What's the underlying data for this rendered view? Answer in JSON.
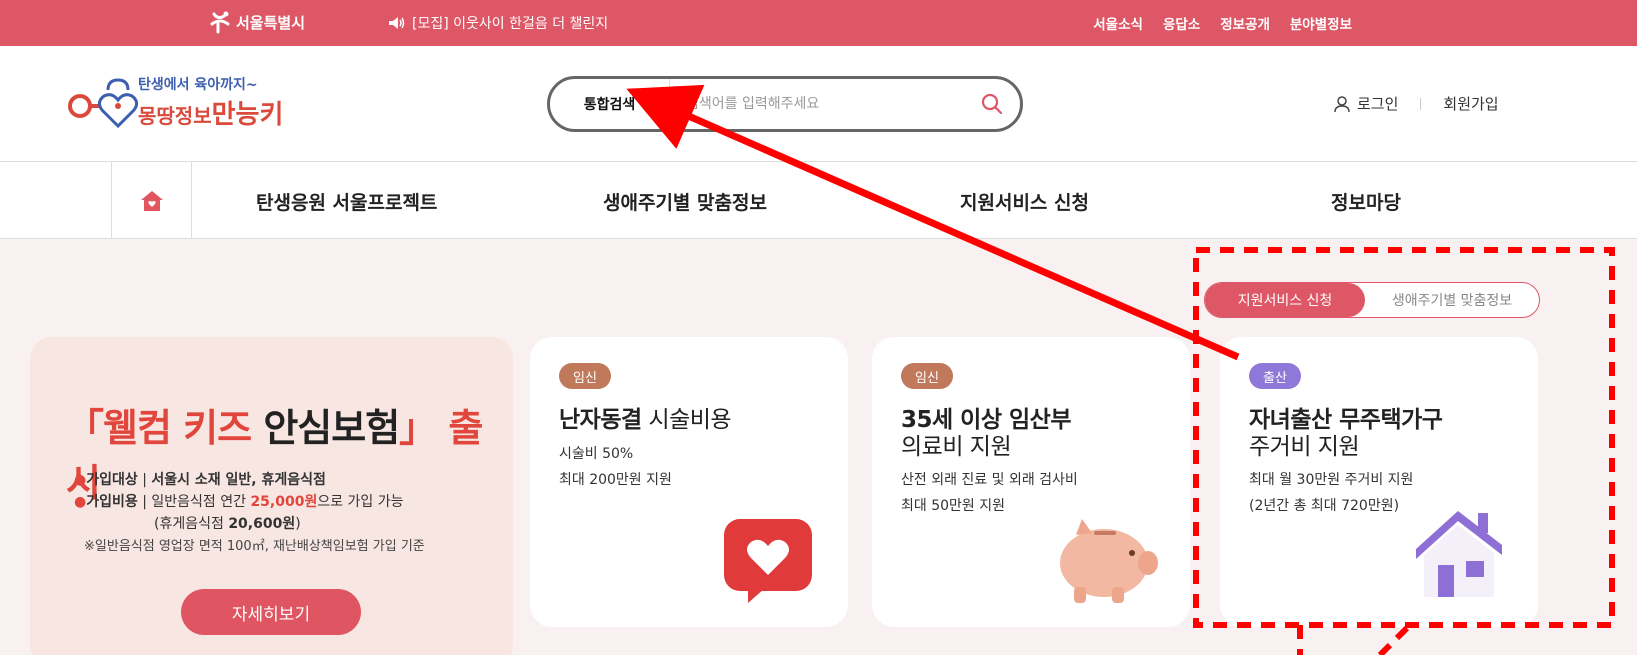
{
  "topbar": {
    "city_logo": "서울특별시",
    "notice": "[모집] 이웃사이 한걸음 더 챌린지",
    "links": [
      "서울소식",
      "응답소",
      "정보공개",
      "분야별정보"
    ]
  },
  "header": {
    "brand_line1": "탄생에서 육아까지~",
    "brand_line2": "몽땅정보",
    "brand_line2_bold": "만능키",
    "search_tab": "통합검색",
    "search_placeholder": "검색어를 입력해주세요",
    "login": "로그인",
    "join": "회원가입"
  },
  "nav": {
    "items": [
      "탄생응원 서울프로젝트",
      "생애주기별 맞춤정보",
      "지원서비스 신청",
      "정보마당"
    ]
  },
  "toggle": {
    "active": "지원서비스 신청",
    "inactive": "생애주기별 맞춤정보"
  },
  "banner": {
    "title_open": "「",
    "title_main": "웰컴 키즈",
    "title_mid": " 안심보험",
    "title_close": "」",
    "title_end": "출시",
    "line1_label": "가입대상",
    "line1_value": "서울시 소재 일반, 휴게음식점",
    "line2_label": "가입비용",
    "line2_pre": "일반음식점 연간 ",
    "line2_amount": "25,000원",
    "line2_post": "으로 가입 가능",
    "line3": "(휴게음식점 ",
    "line3_amount": "20,600원",
    "line3_close": ")",
    "note": "※일반음식점 영업장 면적 100㎡, 재난배상책임보험 가입 기준",
    "more": "자세히보기"
  },
  "cards": [
    {
      "tag": "임신",
      "title_bold": "난자동결",
      "title_rest": " 시술비용",
      "title_line2": "",
      "desc1": "시술비 50%",
      "desc2": "최대 200만원 지원"
    },
    {
      "tag": "임신",
      "title_bold": "35세 이상 임산부",
      "title_rest": "",
      "title_line2": "의료비 지원",
      "desc1": "산전 외래 진료 및 외래 검사비",
      "desc2": "최대 50만원 지원"
    },
    {
      "tag": "출산",
      "title_bold": "자녀출산 무주택가구",
      "title_rest": "",
      "title_line2": "주거비 지원",
      "desc1": "최대 월 30만원 주거비 지원",
      "desc2": "(2년간 총 최대 720만원)"
    }
  ],
  "colors": {
    "brand": "#dd5766",
    "tag_pregnancy": "#c0795b",
    "tag_birth": "#8e78d8",
    "annotation": "#ff0000"
  }
}
